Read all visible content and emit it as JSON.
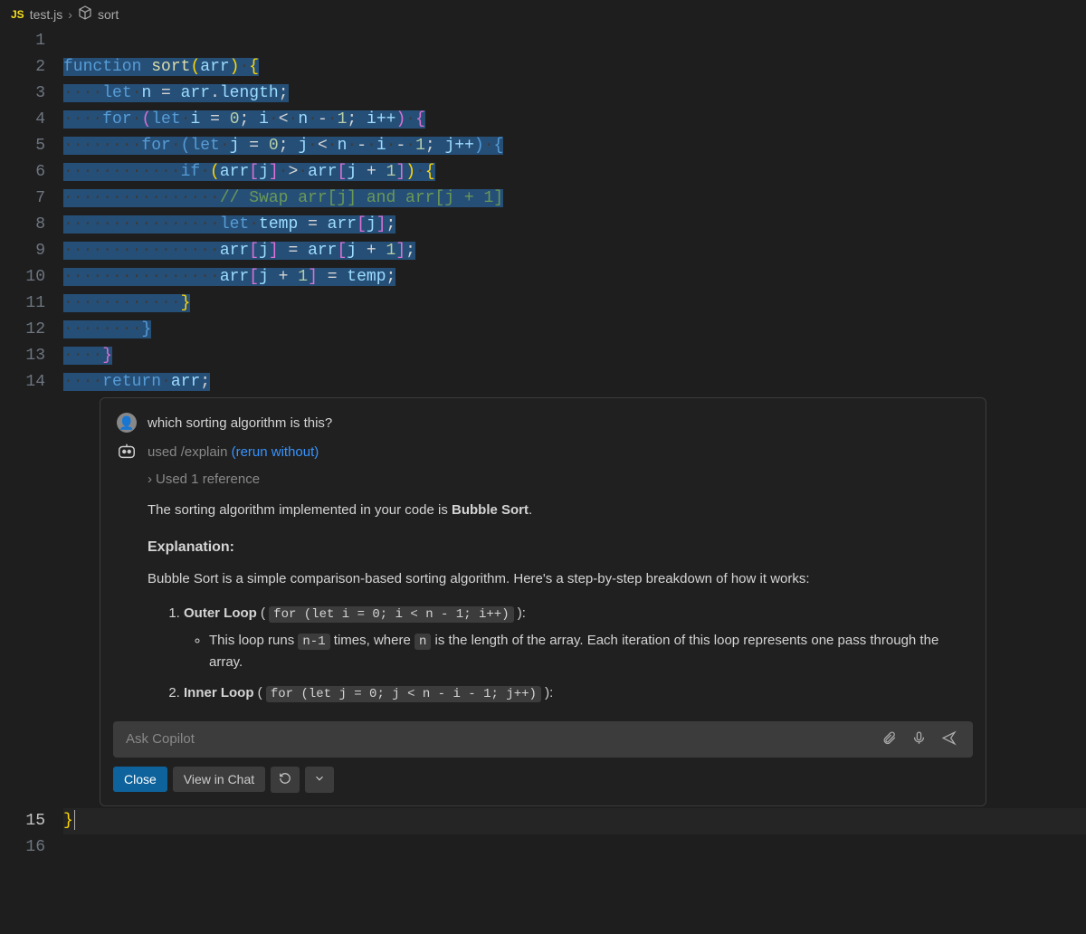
{
  "breadcrumb": {
    "fileIcon": "JS",
    "fileName": "test.js",
    "symbolName": "sort"
  },
  "gutter": {
    "top": [
      "1",
      "2",
      "3",
      "4",
      "5",
      "6",
      "7",
      "8",
      "9",
      "10",
      "11",
      "12",
      "13",
      "14"
    ],
    "bottom": [
      "15",
      "16"
    ]
  },
  "code": {
    "l2_function": "function",
    "l2_sort": "sort",
    "l2_arr": "arr",
    "l3_let": "let",
    "l3_n": "n",
    "l3_arr": "arr",
    "l3_length": "length",
    "l4_for": "for",
    "l4_let": "let",
    "l4_i": "i",
    "l4_zero": "0",
    "l4_i2": "i",
    "l4_n": "n",
    "l4_one": "1",
    "l4_ipp": "i++",
    "l5_for": "for",
    "l5_let": "let",
    "l5_j": "j",
    "l5_zero": "0",
    "l5_j2": "j",
    "l5_n": "n",
    "l5_i": "i",
    "l5_one": "1",
    "l5_jpp": "j++",
    "l6_if": "if",
    "l6_arr1": "arr",
    "l6_j1": "j",
    "l6_arr2": "arr",
    "l6_j2": "j",
    "l6_one": "1",
    "l7_comment": "// Swap arr[j] and arr[j + 1]",
    "l8_let": "let",
    "l8_temp": "temp",
    "l8_arr": "arr",
    "l8_j": "j",
    "l9_arr1": "arr",
    "l9_j1": "j",
    "l9_arr2": "arr",
    "l9_j2": "j",
    "l9_one": "1",
    "l10_arr": "arr",
    "l10_j": "j",
    "l10_one": "1",
    "l10_temp": "temp",
    "l14_return": "return",
    "l14_arr": "arr",
    "l15_brace": "}"
  },
  "chat": {
    "userQuestion": "which sorting algorithm is this?",
    "usedPrefix": "used ",
    "explainCmd": "/explain",
    "rerunLink": "(rerun without)",
    "referenceLine": "Used 1 reference",
    "answerIntroPrefix": "The sorting algorithm implemented in your code is ",
    "answerIntroBold": "Bubble Sort",
    "answerIntroSuffix": ".",
    "explanationHeading": "Explanation:",
    "explanationBody": "Bubble Sort is a simple comparison-based sorting algorithm. Here's a step-by-step breakdown of how it works:",
    "item1Title": "Outer Loop",
    "item1Code": "for (let i = 0; i < n - 1; i++)",
    "item1Desc1": "This loop runs ",
    "item1Code2": "n-1",
    "item1Desc2": " times, where ",
    "item1Code3": "n",
    "item1Desc3": " is the length of the array. Each iteration of this loop represents one pass through the array.",
    "item2Title": "Inner Loop",
    "item2Code": "for (let j = 0; j < n - i - 1; j++)"
  },
  "input": {
    "placeholder": "Ask Copilot"
  },
  "buttons": {
    "close": "Close",
    "viewInChat": "View in Chat"
  }
}
